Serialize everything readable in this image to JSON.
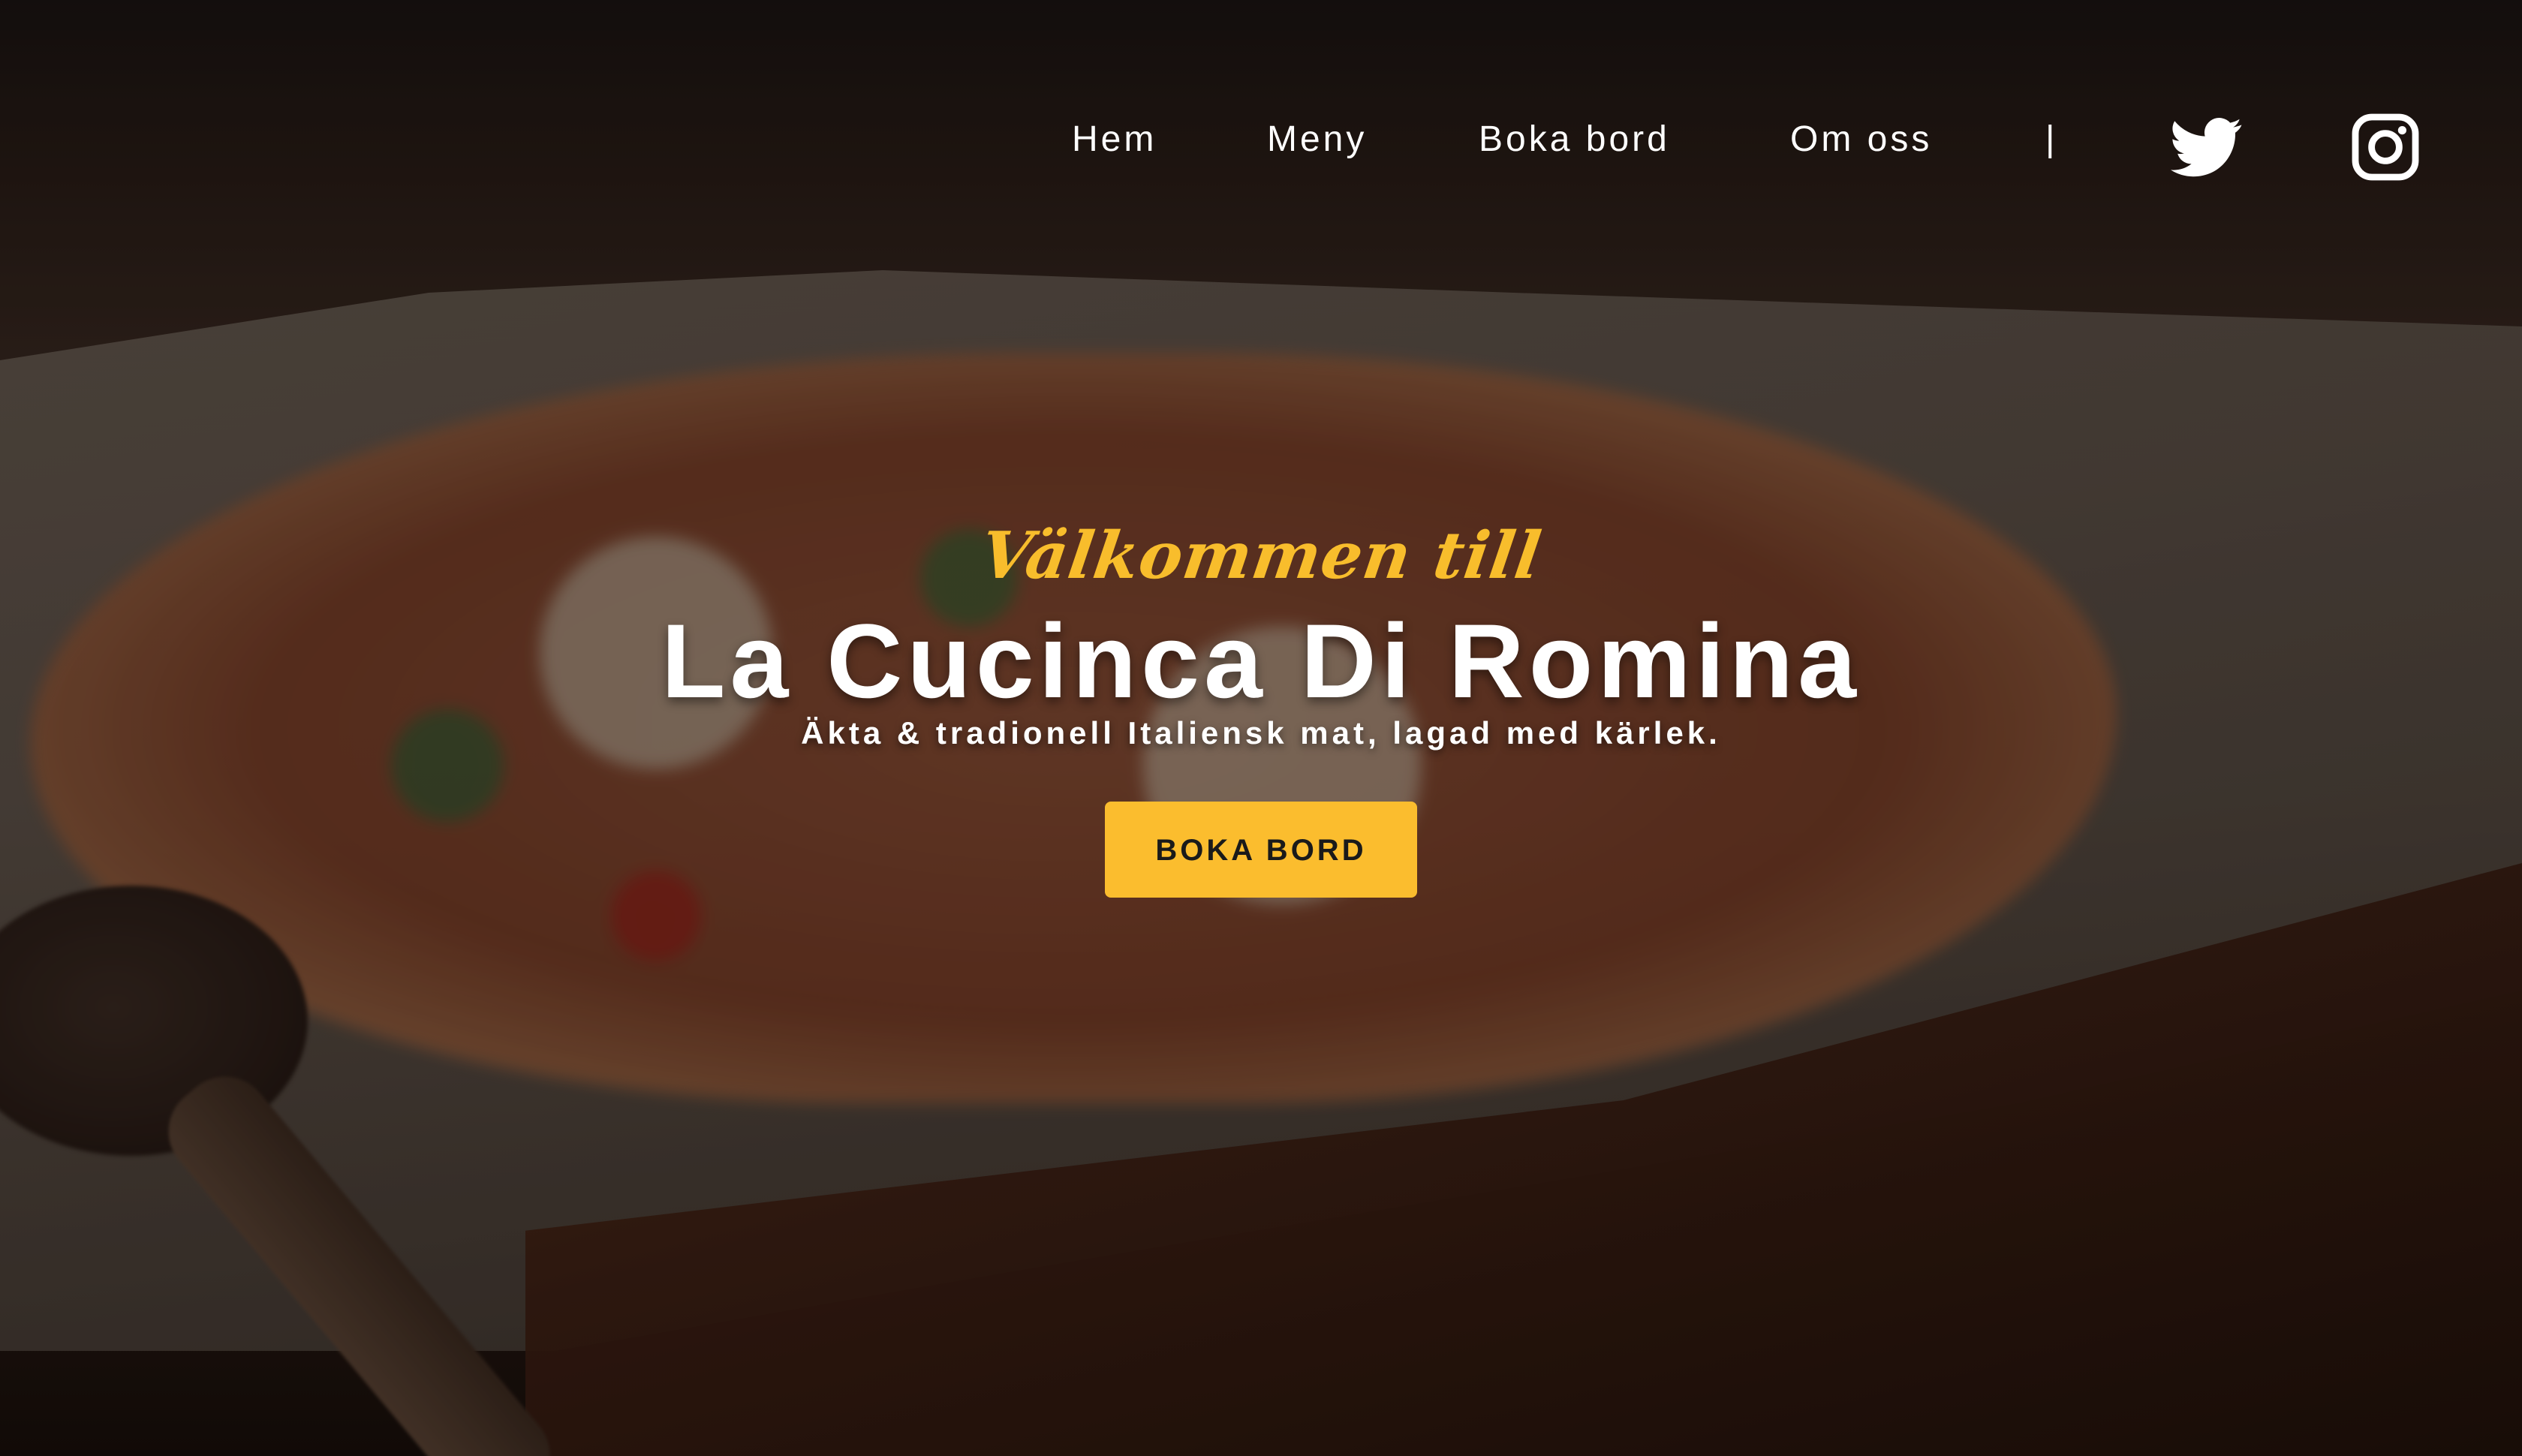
{
  "nav": {
    "links": [
      {
        "label": "Hem"
      },
      {
        "label": "Meny"
      },
      {
        "label": "Boka bord"
      },
      {
        "label": "Om oss"
      }
    ],
    "separator": "|",
    "social": [
      {
        "icon": "twitter-icon"
      },
      {
        "icon": "instagram-icon"
      }
    ]
  },
  "hero": {
    "welcome": "Välkommen till",
    "title": "La Cucinca Di Romina",
    "subtitle": "Äkta & tradionell Italiensk mat, lagad med kärlek.",
    "cta_label": "BOKA BORD"
  },
  "colors": {
    "accent": "#fbbd2e",
    "text": "#ffffff"
  }
}
